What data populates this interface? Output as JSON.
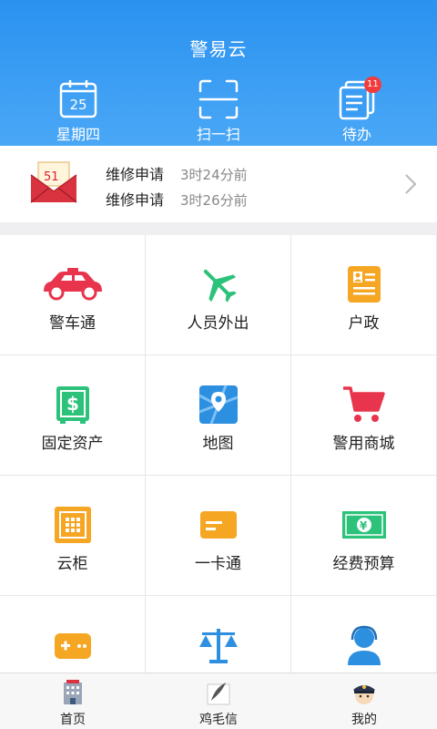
{
  "header": {
    "title": "警易云",
    "buttons": {
      "date": {
        "label": "星期四",
        "day": "25",
        "icon": "calendar-icon"
      },
      "scan": {
        "label": "扫一扫",
        "icon": "scan-icon"
      },
      "todo": {
        "label": "待办",
        "icon": "todo-icon",
        "badge": "11"
      }
    }
  },
  "notice": {
    "icon": "envelope-icon",
    "envelope_text": "51",
    "items": [
      {
        "title": "维修申请",
        "time": "3时24分前"
      },
      {
        "title": "维修申请",
        "time": "3时26分前"
      }
    ]
  },
  "grid": {
    "items": [
      {
        "label": "警车通",
        "icon": "police-car-icon"
      },
      {
        "label": "人员外出",
        "icon": "airplane-icon"
      },
      {
        "label": "户政",
        "icon": "id-card-icon"
      },
      {
        "label": "固定资产",
        "icon": "safe-icon"
      },
      {
        "label": "地图",
        "icon": "map-icon"
      },
      {
        "label": "警用商城",
        "icon": "shopping-cart-icon"
      },
      {
        "label": "云柜",
        "icon": "locker-icon"
      },
      {
        "label": "一卡通",
        "icon": "card-icon"
      },
      {
        "label": "经费预算",
        "icon": "banknote-icon"
      },
      {
        "label": "",
        "icon": "gamepad-icon"
      },
      {
        "label": "",
        "icon": "scales-icon"
      },
      {
        "label": "",
        "icon": "customer-service-icon"
      }
    ]
  },
  "nav": {
    "items": [
      {
        "label": "首页",
        "icon": "home-building-icon"
      },
      {
        "label": "鸡毛信",
        "icon": "feather-letter-icon"
      },
      {
        "label": "我的",
        "icon": "police-avatar-icon"
      }
    ]
  },
  "colors": {
    "header_top": "#2a92f0",
    "header_bottom": "#4aa7f6",
    "badge": "#f23c3c",
    "car_red": "#e8354d",
    "green": "#2cc27a",
    "orange": "#f5a623",
    "blue_icon": "#2d8fe0"
  }
}
